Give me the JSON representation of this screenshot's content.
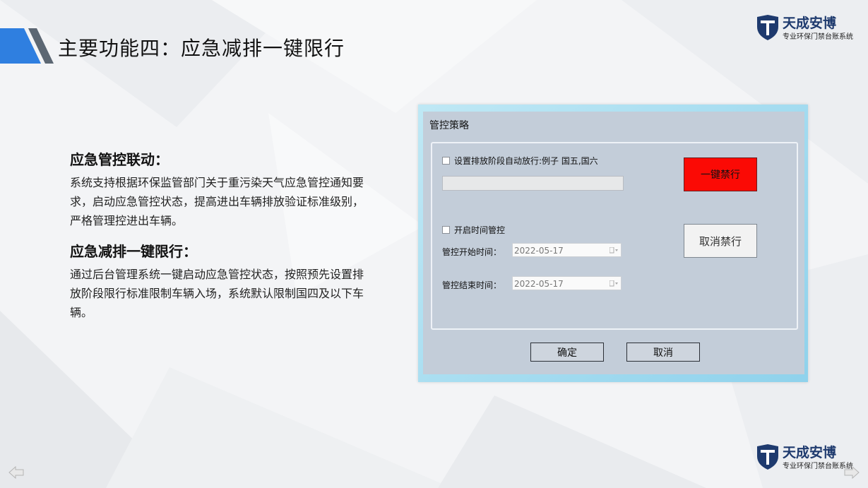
{
  "page": {
    "title": "主要功能四：应急减排一键限行"
  },
  "brand": {
    "name": "天成安博",
    "subtitle": "专业环保门禁台账系统"
  },
  "sections": [
    {
      "heading": "应急管控联动：",
      "body": "系统支持根据环保监管部门关于重污染天气应急管控通知要求，启动应急管控状态，提高进出车辆排放验证标准级别，严格管理控进出车辆。"
    },
    {
      "heading": "应急减排一键限行：",
      "body": "通过后台管理系统一键启动应急管控状态，按照预先设置排放阶段限行标准限制车辆入场，系统默认限制国四及以下车辆。"
    }
  ],
  "dialog": {
    "title": "管控策略",
    "auto_release_label": "设置排放阶段自动放行:例子 国五,国六",
    "auto_release_value": "",
    "time_control_label": "开启时间管控",
    "start_label": "管控开始时间：",
    "start_value": "2022-05-17",
    "end_label": "管控结束时间：",
    "end_value": "2022-05-17",
    "ban_button": "一键禁行",
    "cancel_ban_button": "取消禁行",
    "ok_button": "确定",
    "cancel_button": "取消"
  },
  "colors": {
    "ban_red": "#fb0a05",
    "brand_blue": "#1e3a6e",
    "accent_blue": "#2f7fe0"
  },
  "icons": [
    "shield-logo-icon",
    "calendar-dropdown-icon",
    "prev-arrow-icon",
    "next-arrow-icon"
  ]
}
